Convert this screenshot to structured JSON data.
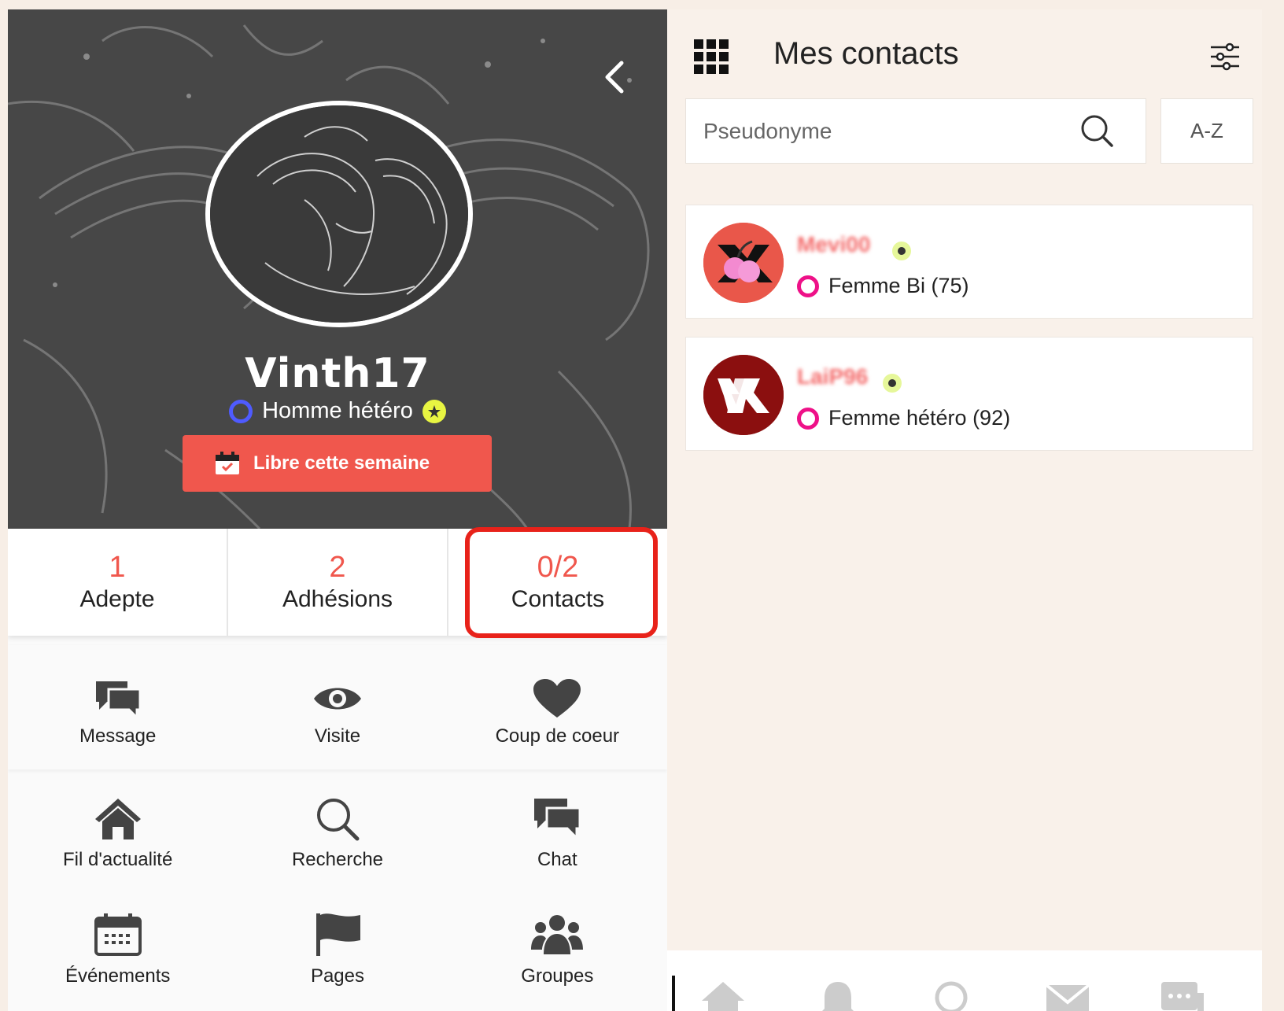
{
  "profile": {
    "username": "Vinth17",
    "gender_label": "Homme hétéro",
    "availability_button": "Libre cette semaine"
  },
  "stats": [
    {
      "value": "1",
      "label": "Adepte"
    },
    {
      "value": "2",
      "label": "Adhésions"
    },
    {
      "value": "0/2",
      "label": "Contacts"
    }
  ],
  "actions": [
    {
      "label": "Message",
      "icon": "chat-bubbles-icon"
    },
    {
      "label": "Visite",
      "icon": "eye-icon"
    },
    {
      "label": "Coup de coeur",
      "icon": "heart-icon"
    }
  ],
  "menu": [
    {
      "label": "Fil d'actualité",
      "icon": "home-icon"
    },
    {
      "label": "Recherche",
      "icon": "search-icon"
    },
    {
      "label": "Chat",
      "icon": "chat-icon"
    },
    {
      "label": "Événements",
      "icon": "calendar-icon"
    },
    {
      "label": "Pages",
      "icon": "flag-icon"
    },
    {
      "label": "Groupes",
      "icon": "group-icon"
    }
  ],
  "contacts_panel": {
    "title": "Mes contacts",
    "search_placeholder": "Pseudonyme",
    "sort_label": "A-Z",
    "contacts": [
      {
        "name": "Mevi00",
        "gender": "Femme Bi (75)"
      },
      {
        "name": "LaiP96",
        "gender": "Femme hétéro (92)"
      }
    ]
  },
  "bottom_nav": [
    "home-icon",
    "bell-icon",
    "search-icon",
    "mail-icon",
    "chat-icon"
  ],
  "colors": {
    "accent": "#f0574d",
    "highlight": "#e8221a",
    "male_ring": "#4f5bff",
    "female_ring": "#ee1188",
    "online": "#e6f79a",
    "panel_bg": "#f9f1ea"
  }
}
